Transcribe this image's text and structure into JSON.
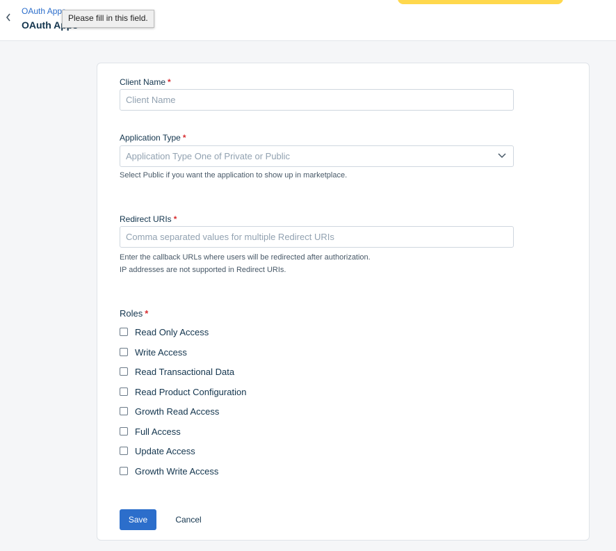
{
  "header": {
    "breadcrumb": "OAuth Apps",
    "title": "OAuth Apps",
    "tooltip": "Please fill in this field."
  },
  "form": {
    "client_name": {
      "label": "Client Name",
      "required": "*",
      "placeholder": "Client Name",
      "value": ""
    },
    "application_type": {
      "label": "Application Type",
      "required": "*",
      "placeholder": "Application Type One of Private or Public",
      "help": "Select Public if you want the application to show up in marketplace."
    },
    "redirect_uris": {
      "label": "Redirect URIs",
      "required": "*",
      "placeholder": "Comma separated values for multiple Redirect URIs",
      "value": "",
      "help_line1": "Enter the callback URLs where users will be redirected after authorization.",
      "help_line2": "IP addresses are not supported in Redirect URIs."
    },
    "roles": {
      "label": "Roles",
      "required": "*",
      "items": [
        {
          "label": "Read Only Access",
          "checked": false
        },
        {
          "label": "Write Access",
          "checked": false
        },
        {
          "label": "Read Transactional Data",
          "checked": false
        },
        {
          "label": "Read Product Configuration",
          "checked": false
        },
        {
          "label": "Growth Read Access",
          "checked": false
        },
        {
          "label": "Full Access",
          "checked": false
        },
        {
          "label": "Update Access",
          "checked": false
        },
        {
          "label": "Growth Write Access",
          "checked": false
        }
      ]
    },
    "actions": {
      "save_label": "Save",
      "cancel_label": "Cancel"
    }
  },
  "colors": {
    "primary": "#2c6ecb",
    "required": "#d72d30",
    "banner": "#ffd84d"
  }
}
